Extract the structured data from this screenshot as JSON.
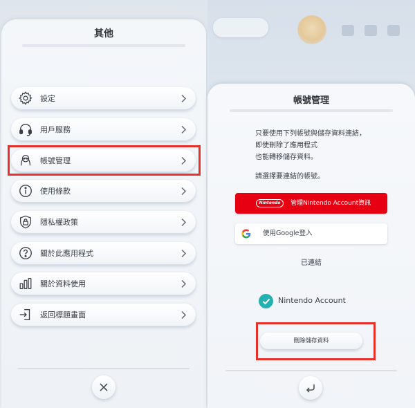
{
  "left": {
    "title": "其他",
    "menu": [
      {
        "label": "設定",
        "icon": "gear-icon"
      },
      {
        "label": "用戶服務",
        "icon": "headset-icon"
      },
      {
        "label": "帳號管理",
        "icon": "account-icon"
      },
      {
        "label": "使用條款",
        "icon": "info-icon"
      },
      {
        "label": "隱私權政策",
        "icon": "shield-lock-icon"
      },
      {
        "label": "關於此應用程式",
        "icon": "question-icon"
      },
      {
        "label": "關於資料使用",
        "icon": "bar-chart-icon"
      },
      {
        "label": "返回標題畫面",
        "icon": "exit-icon"
      }
    ],
    "highlighted_item": "帳號管理",
    "close_icon": "close-icon"
  },
  "right": {
    "title": "帳號管理",
    "description": [
      "只要使用下列帳號與儲存資料連結，",
      "即使刪除了應用程式",
      "也能轉移儲存資料。"
    ],
    "prompt": "請選擇要連結的帳號。",
    "nintendo_logo": "Nintendo",
    "nintendo_button": "管理Nintendo Account資訊",
    "google_button": "使用Google登入",
    "linked_header": "已連結",
    "linked_account": "Nintendo Account",
    "delete_button": "刪除儲存資料",
    "back_icon": "back-icon"
  },
  "colors": {
    "highlight": "#e8302b",
    "nintendo_red": "#e60012",
    "check_teal": "#23b1b1"
  }
}
